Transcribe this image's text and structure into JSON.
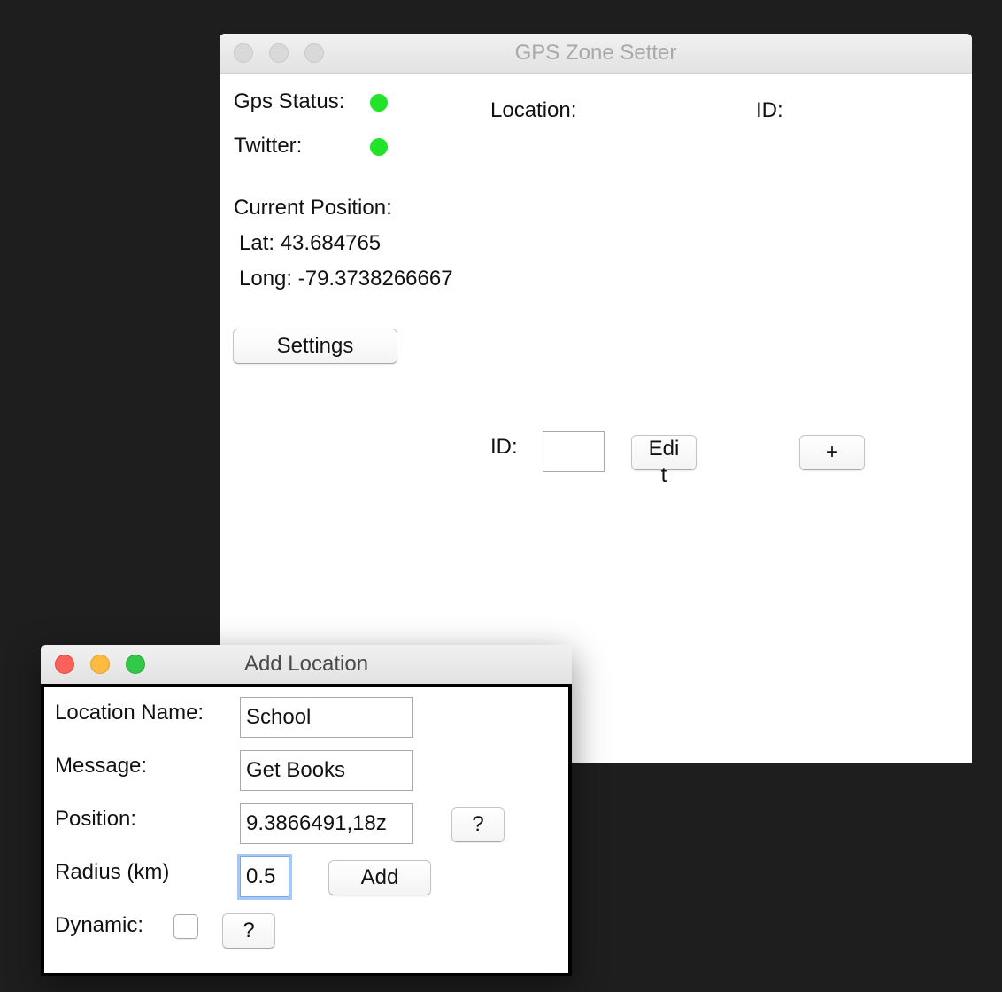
{
  "main_window": {
    "title": "GPS Zone Setter",
    "gps_status_label": "Gps Status:",
    "twitter_label": "Twitter:",
    "status_color": "#22e22a",
    "current_position_label": "Current Position:",
    "lat_text": "Lat: 43.684765",
    "long_text": "Long: -79.3738266667",
    "settings_button": "Settings",
    "location_header": "Location:",
    "id_header": "ID:",
    "id_field_label": "ID:",
    "id_field_value": "",
    "edit_button": "Edi\nt",
    "add_button": "+"
  },
  "add_location_window": {
    "title": "Add Location",
    "location_name_label": "Location Name:",
    "location_name_value": "School",
    "message_label": "Message:",
    "message_value": "Get Books",
    "position_label": "Position:",
    "position_value": "9.3866491,18z",
    "position_help_button": "?",
    "radius_label": "Radius (km)",
    "radius_value": "0.5",
    "add_button": "Add",
    "dynamic_label": "Dynamic:",
    "dynamic_checked": false,
    "dynamic_help_button": "?"
  }
}
